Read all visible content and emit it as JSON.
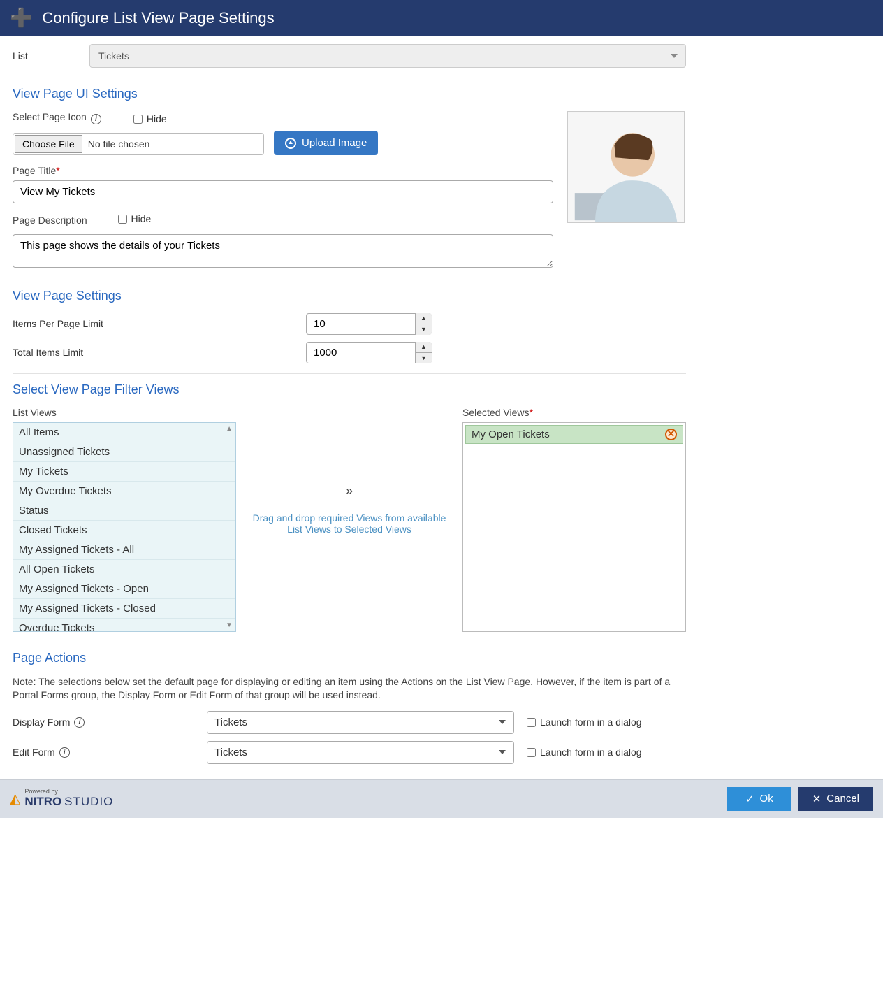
{
  "header": {
    "title": "Configure List View Page Settings"
  },
  "list": {
    "label": "List",
    "value": "Tickets"
  },
  "section_ui": {
    "title": "View Page UI Settings",
    "select_icon_label": "Select Page Icon",
    "hide_label": "Hide",
    "choose_file_label": "Choose File",
    "no_file_label": "No file chosen",
    "upload_label": "Upload Image",
    "page_title_label": "Page Title",
    "page_title_value": "View My Tickets",
    "page_desc_label": "Page Description",
    "page_desc_hide_label": "Hide",
    "page_desc_value": "This page shows the details of your Tickets"
  },
  "section_settings": {
    "title": "View Page Settings",
    "items_per_page_label": "Items Per Page Limit",
    "items_per_page_value": "10",
    "total_items_label": "Total Items Limit",
    "total_items_value": "1000"
  },
  "section_filter": {
    "title": "Select View Page Filter Views",
    "list_views_label": "List Views",
    "selected_views_label": "Selected Views",
    "hint": "Drag and drop required Views from available List Views to Selected Views",
    "list_views": [
      "All Items",
      "Unassigned Tickets",
      "My Tickets",
      "My Overdue Tickets",
      "Status",
      "Closed Tickets",
      "My Assigned Tickets - All",
      "All Open Tickets",
      "My Assigned Tickets - Open",
      "My Assigned Tickets - Closed",
      "Overdue Tickets"
    ],
    "selected_views": [
      "My Open Tickets"
    ]
  },
  "section_actions": {
    "title": "Page Actions",
    "note": "Note: The selections below set the default page for displaying or editing an item using the Actions on the List View Page. However, if the item is part of a Portal Forms group, the Display Form or Edit Form of that group will be used instead.",
    "display_form_label": "Display Form",
    "display_form_value": "Tickets",
    "edit_form_label": "Edit Form",
    "edit_form_value": "Tickets",
    "launch_dialog_label": "Launch form in a dialog"
  },
  "footer": {
    "powered_by": "Powered by",
    "brand1": "NITRO",
    "brand2": "STUDIO",
    "ok_label": "Ok",
    "cancel_label": "Cancel"
  }
}
